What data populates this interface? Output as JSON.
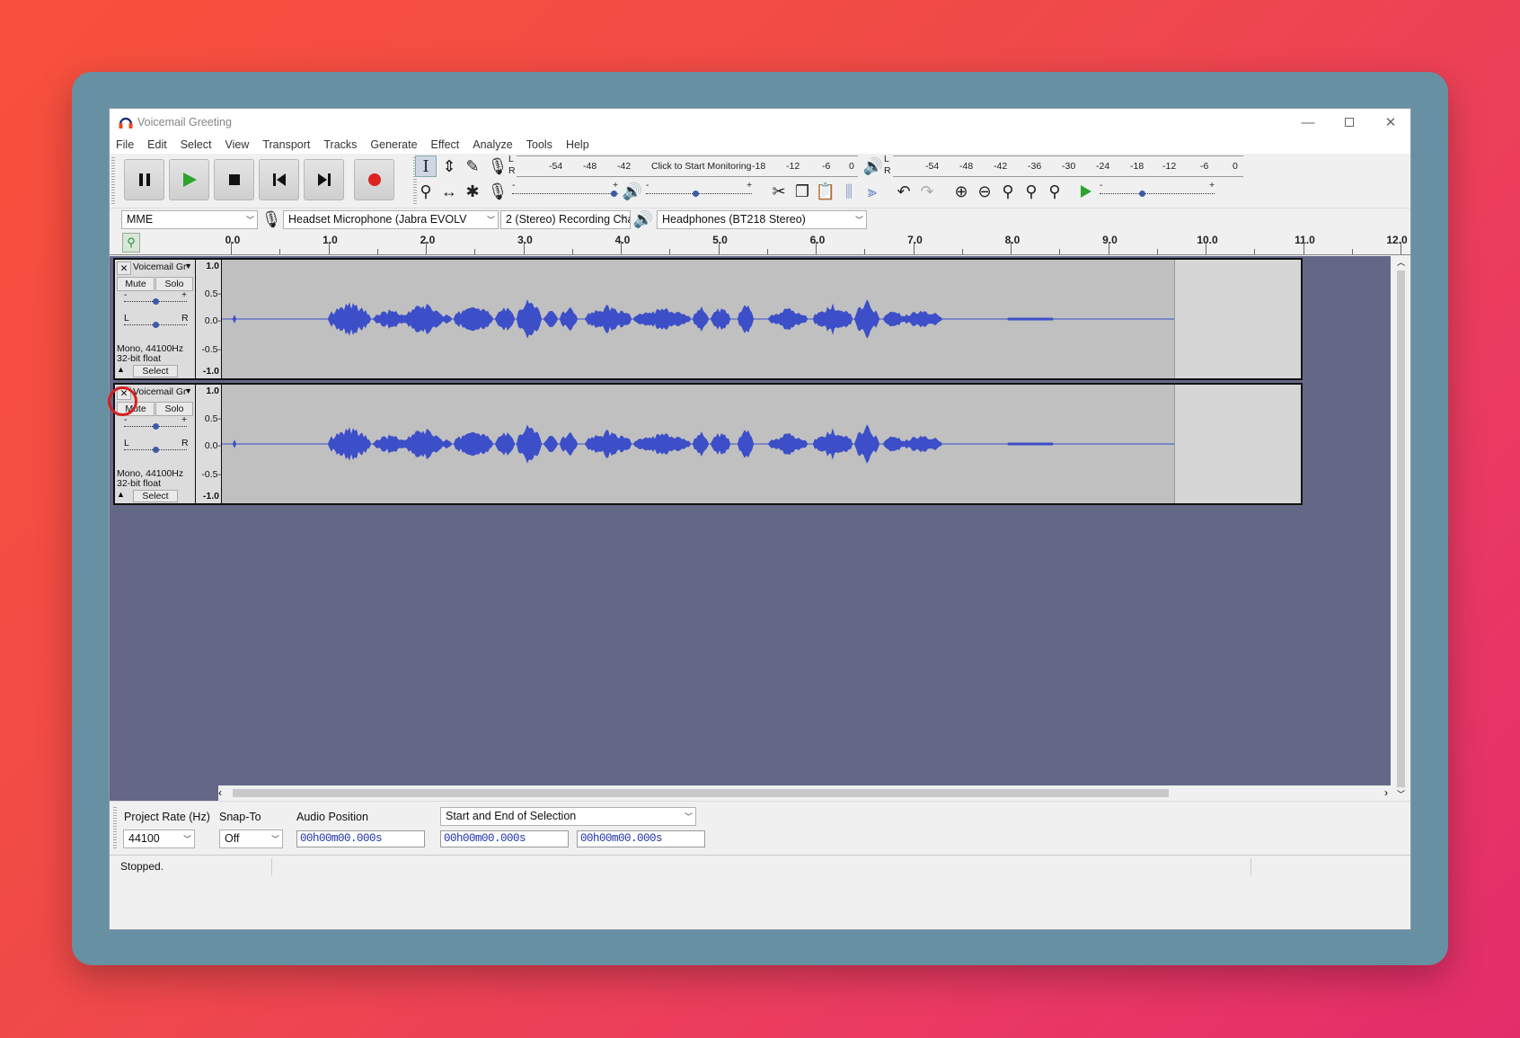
{
  "window": {
    "title": "Voicemail Greeting"
  },
  "menu": [
    "File",
    "Edit",
    "Select",
    "View",
    "Transport",
    "Tracks",
    "Generate",
    "Effect",
    "Analyze",
    "Tools",
    "Help"
  ],
  "meters": {
    "record_scale": [
      "-54",
      "-48",
      "-42",
      "Click to Start Monitoring",
      "-18",
      "-12",
      "-6",
      "0"
    ],
    "play_scale": [
      "-54",
      "-48",
      "-42",
      "-36",
      "-30",
      "-24",
      "-18",
      "-12",
      "-6",
      "0"
    ],
    "lr_top": "L",
    "lr_bottom": "R"
  },
  "device": {
    "host": "MME",
    "input": "Headset Microphone (Jabra EVOLV",
    "channels": "2 (Stereo) Recording Chai",
    "output": "Headphones (BT218 Stereo)"
  },
  "ruler": {
    "ticks": [
      "0.0",
      "1.0",
      "2.0",
      "3.0",
      "4.0",
      "5.0",
      "6.0",
      "7.0",
      "8.0",
      "9.0",
      "10.0",
      "11.0",
      "12.0"
    ]
  },
  "tracks": [
    {
      "name": "Voicemail Gr",
      "mute": "Mute",
      "solo": "Solo",
      "gain_minus": "-",
      "gain_plus": "+",
      "pan_l": "L",
      "pan_r": "R",
      "info1": "Mono, 44100Hz",
      "info2": "32-bit float",
      "select": "Select",
      "scale": [
        "1.0",
        "0.5-",
        "0.0-",
        "-0.5-",
        "-1.0"
      ]
    },
    {
      "name": "Voicemail Gr",
      "mute": "Mute",
      "solo": "Solo",
      "gain_minus": "-",
      "gain_plus": "+",
      "pan_l": "L",
      "pan_r": "R",
      "info1": "Mono, 44100Hz",
      "info2": "32-bit float",
      "select": "Select",
      "scale": [
        "1.0",
        "0.5-",
        "0.0-",
        "-0.5-",
        "-1.0"
      ]
    }
  ],
  "selection": {
    "project_rate_label": "Project Rate (Hz)",
    "project_rate": "44100",
    "snap_label": "Snap-To",
    "snap_value": "Off",
    "audio_position_label": "Audio Position",
    "audio_position": "00h00m00.000s",
    "mode": "Start and End of Selection",
    "start": "00h00m00.000s",
    "end": "00h00m00.000s"
  },
  "status": "Stopped.",
  "colors": {
    "wave": "#3c4fc8",
    "track_bg": "#c0c0c0",
    "tracks_area": "#646887",
    "accent_record": "#dd2222",
    "play": "#2ea32e"
  }
}
